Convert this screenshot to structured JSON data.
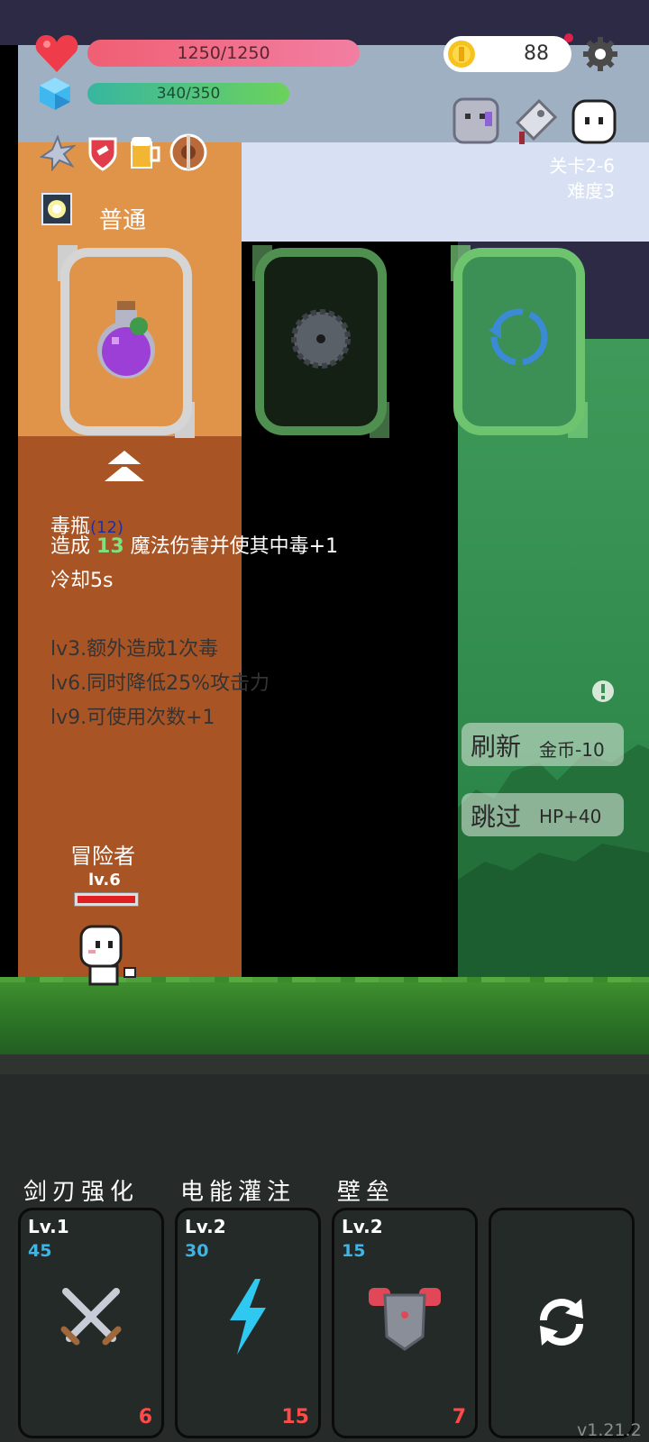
{
  "hud": {
    "hp_text": "1250/1250",
    "mp_text": "340/350",
    "coins": "88",
    "stage_label": "关卡2-6",
    "difficulty_label": "难度3"
  },
  "selection": {
    "grade": "普通",
    "item_name": "毒瓶",
    "item_count": "12",
    "desc_prefix": "造成",
    "desc_value": "13",
    "desc_suffix": "魔法伤害并使其中毒+1",
    "cooldown": "冷却5s",
    "levels": [
      "lv3.额外造成1次毒",
      "lv6.同时降低25%攻击力",
      "lv9.可使用次数+1"
    ]
  },
  "actions": {
    "refresh_label": "刷新",
    "refresh_cost": "金币-10",
    "skip_label": "跳过",
    "skip_reward": "HP+40"
  },
  "hero": {
    "name": "冒险者",
    "level": "lv.6"
  },
  "upgrades": [
    {
      "title": "剑刃强化",
      "level": "Lv.1",
      "value": "45",
      "cost": "6",
      "icon": "crossed-swords-icon"
    },
    {
      "title": "电能灌注",
      "level": "Lv.2",
      "value": "30",
      "cost": "15",
      "icon": "lightning-icon"
    },
    {
      "title": "壁垒",
      "level": "Lv.2",
      "value": "15",
      "cost": "7",
      "icon": "armor-icon"
    }
  ],
  "version": "v1.21.2",
  "colors": {
    "hp": "#f05f73",
    "mp": "#37b6a0",
    "accent_green": "#5bbf6a",
    "cost_red": "#ff4a4a",
    "upgrade_value_blue": "#3fb4e6"
  }
}
